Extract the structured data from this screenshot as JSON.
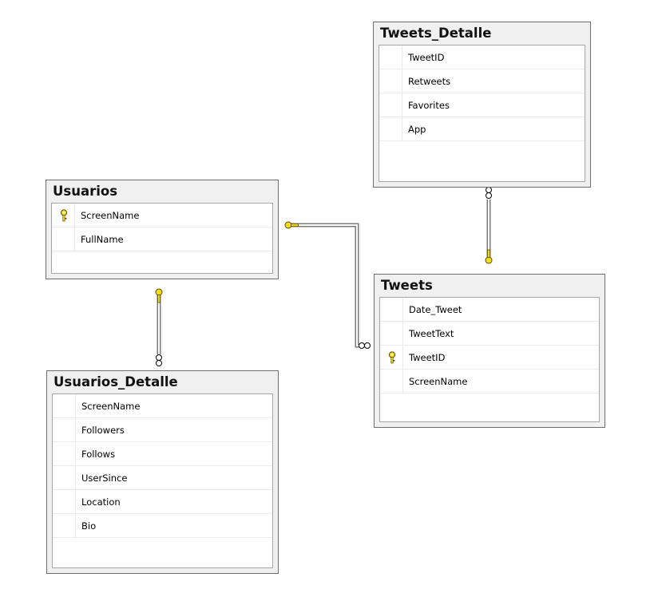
{
  "colors": {
    "table_header_bg": "#f0f0f0",
    "table_border": "#6d6d6d",
    "relationship_line": "#7a7a7a",
    "key_icon": "#f2dc1a"
  },
  "tables": {
    "usuarios": {
      "name": "Usuarios",
      "columns": [
        {
          "name": "ScreenName",
          "icon": "primary-key-icon"
        },
        {
          "name": "FullName"
        }
      ]
    },
    "usuarios_detalle": {
      "name": "Usuarios_Detalle",
      "columns": [
        {
          "name": "ScreenName"
        },
        {
          "name": "Followers"
        },
        {
          "name": "Follows"
        },
        {
          "name": "UserSince"
        },
        {
          "name": "Location"
        },
        {
          "name": "Bio"
        }
      ]
    },
    "tweets_detalle": {
      "name": "Tweets_Detalle",
      "columns": [
        {
          "name": "TweetID"
        },
        {
          "name": "Retweets"
        },
        {
          "name": "Favorites"
        },
        {
          "name": "App"
        }
      ]
    },
    "tweets": {
      "name": "Tweets",
      "columns": [
        {
          "name": "Date_Tweet"
        },
        {
          "name": "TweetText"
        },
        {
          "name": "TweetID",
          "icon": "primary-key-icon"
        },
        {
          "name": "ScreenName"
        }
      ]
    }
  },
  "relationships": [
    {
      "from": "Usuarios",
      "to": "Usuarios_Detalle",
      "one_end": "Usuarios",
      "many_end": "Usuarios_Detalle"
    },
    {
      "from": "Usuarios",
      "to": "Tweets",
      "one_end": "Usuarios",
      "many_end": "Tweets"
    },
    {
      "from": "Tweets",
      "to": "Tweets_Detalle",
      "one_end": "Tweets",
      "many_end": "Tweets_Detalle"
    }
  ]
}
